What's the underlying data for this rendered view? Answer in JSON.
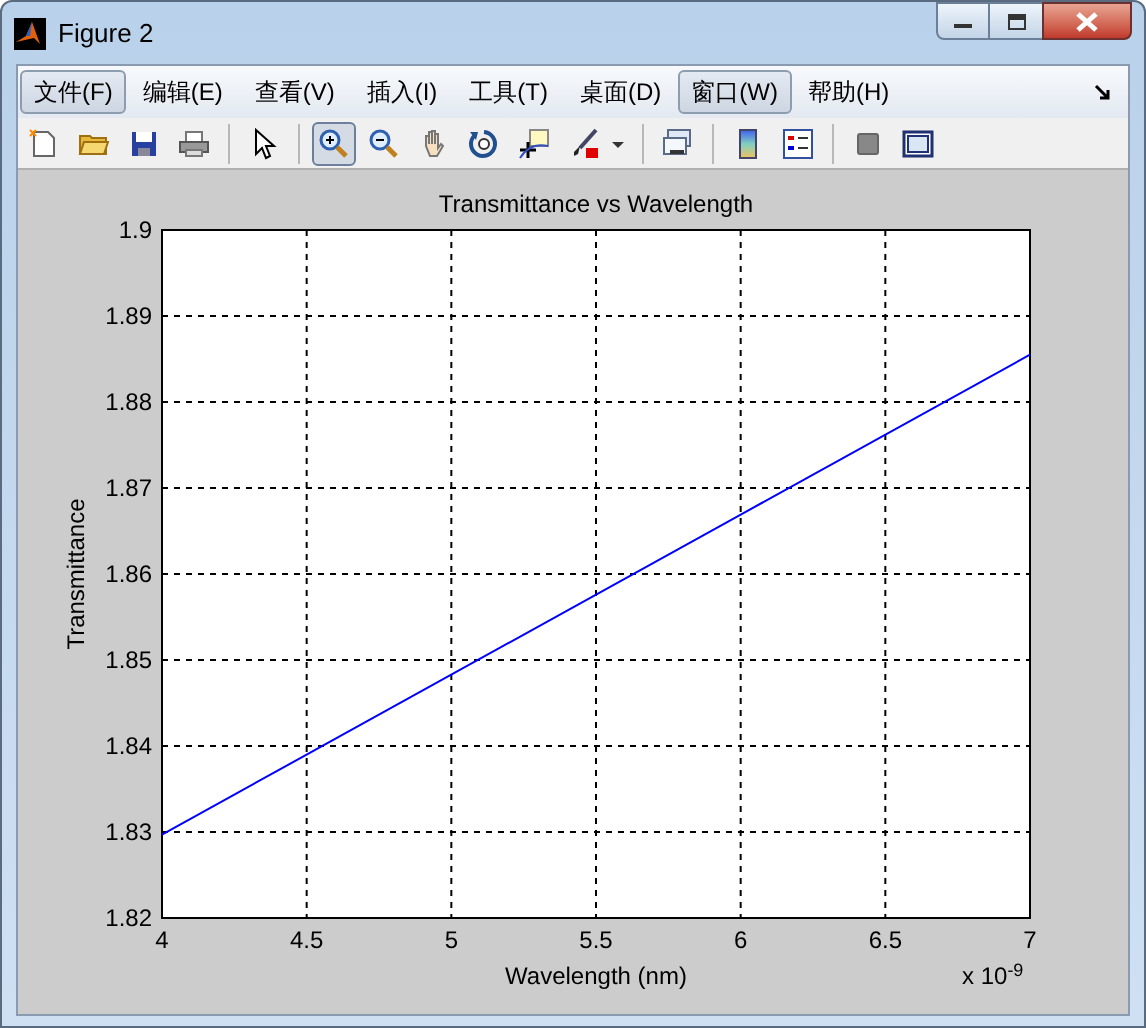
{
  "window": {
    "title": "Figure 2"
  },
  "menu": [
    {
      "label": "文件(F)",
      "selected": true
    },
    {
      "label": "编辑(E)",
      "selected": false
    },
    {
      "label": "查看(V)",
      "selected": false
    },
    {
      "label": "插入(I)",
      "selected": false
    },
    {
      "label": "工具(T)",
      "selected": false
    },
    {
      "label": "桌面(D)",
      "selected": false
    },
    {
      "label": "窗口(W)",
      "selected": true
    },
    {
      "label": "帮助(H)",
      "selected": false
    }
  ],
  "toolbar": [
    {
      "pressed": false
    },
    {
      "pressed": false
    },
    {
      "pressed": false
    },
    {
      "pressed": false
    },
    {
      "pressed": false
    },
    {
      "pressed": true
    },
    {
      "pressed": false
    },
    {
      "pressed": false
    },
    {
      "pressed": false
    },
    {
      "pressed": false
    },
    {
      "pressed": false
    },
    {
      "pressed": false
    },
    {
      "pressed": false
    },
    {
      "pressed": false
    },
    {
      "pressed": false
    },
    {
      "pressed": false
    }
  ],
  "figure": {
    "chart_data": {
      "type": "line",
      "title": "Transmittance vs Wavelength",
      "xlabel": "Wavelength (nm)",
      "ylabel": "Transmittance",
      "x": [
        4,
        7
      ],
      "series": [
        {
          "color": "#0000ff",
          "values": [
            1.8297,
            1.8855
          ]
        }
      ],
      "grid": true,
      "xlim": [
        4,
        7
      ],
      "ylim": [
        1.82,
        1.9
      ],
      "xticks": [
        4,
        4.5,
        5,
        5.5,
        6,
        6.5,
        7
      ],
      "yticks": [
        1.82,
        1.83,
        1.84,
        1.85,
        1.86,
        1.87,
        1.88,
        1.89,
        1.9
      ],
      "annotations": [
        {
          "text": "x 10$^{-9}$"
        }
      ]
    }
  }
}
